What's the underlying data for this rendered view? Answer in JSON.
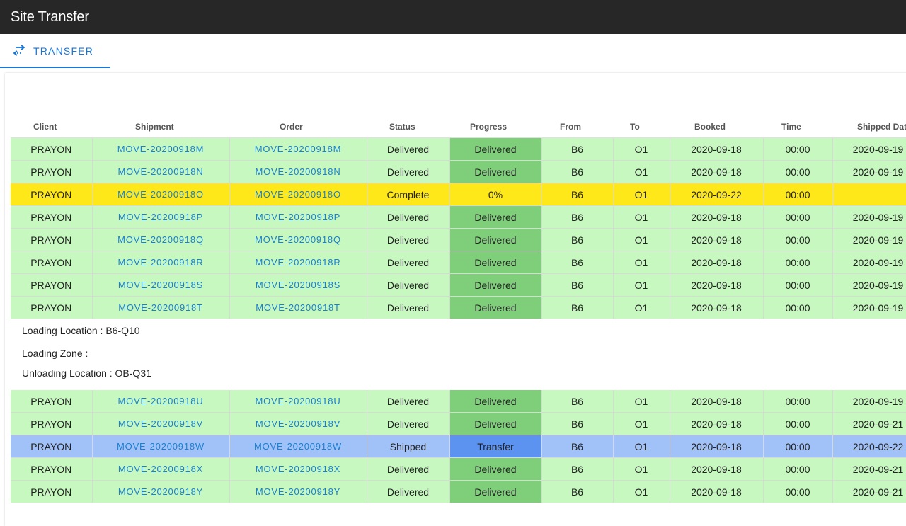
{
  "app": {
    "title": "Site Transfer"
  },
  "tabs": [
    {
      "label": "TRANSFER",
      "icon": "swap-horiz-icon"
    }
  ],
  "colors": {
    "delivered_row": "#c6f8c0",
    "delivered_progress": "#7ece7a",
    "complete_row": "#ffe81a",
    "shipped_row": "#a1c2f8",
    "shipped_progress": "#5c93f0",
    "link": "#1a7fd0",
    "tab_accent": "#1976d2"
  },
  "table": {
    "columns": [
      "Client",
      "Shipment",
      "Order",
      "Status",
      "Progress",
      "From",
      "To",
      "Booked",
      "Time",
      "Shipped Date"
    ],
    "group1": [
      {
        "client": "PRAYON",
        "shipment": "MOVE-20200918M",
        "order": "MOVE-20200918M",
        "status": "Delivered",
        "progress": "Delivered",
        "from": "B6",
        "to": "O1",
        "booked": "2020-09-18",
        "time": "00:00",
        "shipped": "2020-09-19",
        "state": "delivered"
      },
      {
        "client": "PRAYON",
        "shipment": "MOVE-20200918N",
        "order": "MOVE-20200918N",
        "status": "Delivered",
        "progress": "Delivered",
        "from": "B6",
        "to": "O1",
        "booked": "2020-09-18",
        "time": "00:00",
        "shipped": "2020-09-19",
        "state": "delivered"
      },
      {
        "client": "PRAYON",
        "shipment": "MOVE-20200918O",
        "order": "MOVE-20200918O",
        "status": "Complete",
        "progress": "0%",
        "from": "B6",
        "to": "O1",
        "booked": "2020-09-22",
        "time": "00:00",
        "shipped": "",
        "state": "complete"
      },
      {
        "client": "PRAYON",
        "shipment": "MOVE-20200918P",
        "order": "MOVE-20200918P",
        "status": "Delivered",
        "progress": "Delivered",
        "from": "B6",
        "to": "O1",
        "booked": "2020-09-18",
        "time": "00:00",
        "shipped": "2020-09-19",
        "state": "delivered"
      },
      {
        "client": "PRAYON",
        "shipment": "MOVE-20200918Q",
        "order": "MOVE-20200918Q",
        "status": "Delivered",
        "progress": "Delivered",
        "from": "B6",
        "to": "O1",
        "booked": "2020-09-18",
        "time": "00:00",
        "shipped": "2020-09-19",
        "state": "delivered"
      },
      {
        "client": "PRAYON",
        "shipment": "MOVE-20200918R",
        "order": "MOVE-20200918R",
        "status": "Delivered",
        "progress": "Delivered",
        "from": "B6",
        "to": "O1",
        "booked": "2020-09-18",
        "time": "00:00",
        "shipped": "2020-09-19",
        "state": "delivered"
      },
      {
        "client": "PRAYON",
        "shipment": "MOVE-20200918S",
        "order": "MOVE-20200918S",
        "status": "Delivered",
        "progress": "Delivered",
        "from": "B6",
        "to": "O1",
        "booked": "2020-09-18",
        "time": "00:00",
        "shipped": "2020-09-19",
        "state": "delivered"
      },
      {
        "client": "PRAYON",
        "shipment": "MOVE-20200918T",
        "order": "MOVE-20200918T",
        "status": "Delivered",
        "progress": "Delivered",
        "from": "B6",
        "to": "O1",
        "booked": "2020-09-18",
        "time": "00:00",
        "shipped": "2020-09-19",
        "state": "delivered"
      }
    ],
    "location_info": [
      "Loading Location : B6-Q10",
      "Loading Zone :",
      "Unloading Location : OB-Q31"
    ],
    "group2": [
      {
        "client": "PRAYON",
        "shipment": "MOVE-20200918U",
        "order": "MOVE-20200918U",
        "status": "Delivered",
        "progress": "Delivered",
        "from": "B6",
        "to": "O1",
        "booked": "2020-09-18",
        "time": "00:00",
        "shipped": "2020-09-19",
        "state": "delivered"
      },
      {
        "client": "PRAYON",
        "shipment": "MOVE-20200918V",
        "order": "MOVE-20200918V",
        "status": "Delivered",
        "progress": "Delivered",
        "from": "B6",
        "to": "O1",
        "booked": "2020-09-18",
        "time": "00:00",
        "shipped": "2020-09-21",
        "state": "delivered"
      },
      {
        "client": "PRAYON",
        "shipment": "MOVE-20200918W",
        "order": "MOVE-20200918W",
        "status": "Shipped",
        "progress": "Transfer",
        "from": "B6",
        "to": "O1",
        "booked": "2020-09-18",
        "time": "00:00",
        "shipped": "2020-09-22",
        "state": "shipped"
      },
      {
        "client": "PRAYON",
        "shipment": "MOVE-20200918X",
        "order": "MOVE-20200918X",
        "status": "Delivered",
        "progress": "Delivered",
        "from": "B6",
        "to": "O1",
        "booked": "2020-09-18",
        "time": "00:00",
        "shipped": "2020-09-21",
        "state": "delivered"
      },
      {
        "client": "PRAYON",
        "shipment": "MOVE-20200918Y",
        "order": "MOVE-20200918Y",
        "status": "Delivered",
        "progress": "Delivered",
        "from": "B6",
        "to": "O1",
        "booked": "2020-09-18",
        "time": "00:00",
        "shipped": "2020-09-21",
        "state": "delivered"
      }
    ]
  }
}
